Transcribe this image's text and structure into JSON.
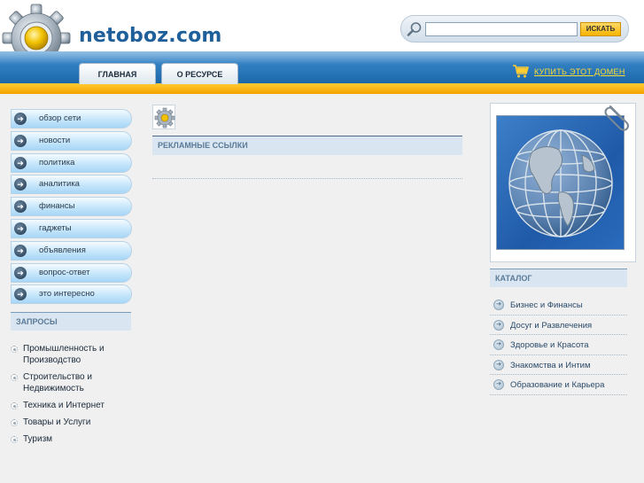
{
  "header": {
    "site_title": "netoboz.com",
    "logo_icon": "gear-logo-icon",
    "search": {
      "placeholder": "",
      "value": "",
      "button_label": "ИСКАТЬ",
      "icon": "magnifier-icon"
    },
    "tabs": [
      {
        "label": "ГЛАВНАЯ"
      },
      {
        "label": "О РЕСУРСЕ"
      }
    ],
    "buy_link": {
      "label": "КУПИТЬ ЭТОТ ДОМЕН",
      "icon": "cart-icon"
    }
  },
  "left_nav": {
    "items": [
      {
        "label": "обзор сети"
      },
      {
        "label": "новости"
      },
      {
        "label": "политика"
      },
      {
        "label": "аналитика"
      },
      {
        "label": "финансы"
      },
      {
        "label": "гаджеты"
      },
      {
        "label": "объявления"
      },
      {
        "label": "вопрос-ответ"
      },
      {
        "label": "это интересно"
      }
    ]
  },
  "requests": {
    "title": "ЗАПРОСЫ",
    "items": [
      {
        "label": "Промышленность и Производство"
      },
      {
        "label": "Строительство и Недвижимость"
      },
      {
        "label": "Техника и Интернет"
      },
      {
        "label": "Товары и Услуги"
      },
      {
        "label": "Туризм"
      }
    ]
  },
  "main": {
    "ads_title": "РЕКЛАМНЫЕ ССЫЛКИ"
  },
  "catalog": {
    "title": "КАТАЛОГ",
    "items": [
      {
        "label": "Бизнес и Финансы"
      },
      {
        "label": "Досуг и Развлечения"
      },
      {
        "label": "Здоровье и Красота"
      },
      {
        "label": "Знакомства и Интим"
      },
      {
        "label": "Образование и Карьера"
      }
    ]
  },
  "colors": {
    "brand_blue": "#1f5f9a",
    "band_blue": "#2f7dc0",
    "orange": "#f5a000",
    "link_yellow": "#ffdd33"
  }
}
